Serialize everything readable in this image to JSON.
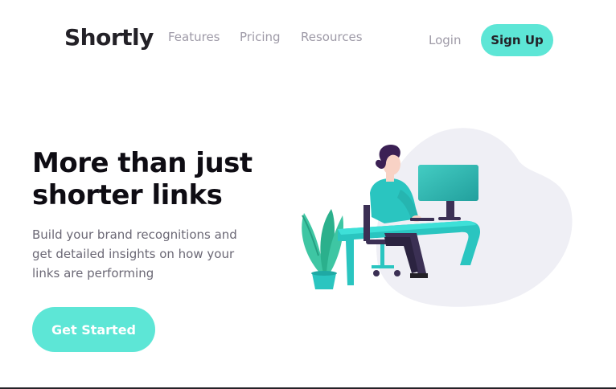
{
  "header": {
    "logo": "Shortly",
    "nav": [
      "Features",
      "Pricing",
      "Resources"
    ],
    "login_label": "Login",
    "signup_label": "Sign Up"
  },
  "hero": {
    "title_line1": "More than just",
    "title_line2": "shorter links",
    "subtitle_line1": "Build your brand recognitions and",
    "subtitle_line2": "get detailed insights on how your",
    "subtitle_line3": "links are performing",
    "cta_label": "Get Started"
  },
  "colors": {
    "accent": "#5de6d6",
    "text_dark": "#232127",
    "text_muted": "#9e9aa7",
    "blob": "#efeff5",
    "desk": "#2ac5c0"
  },
  "icons": [
    "person-at-desk-illustration",
    "plant-illustration",
    "monitor-illustration"
  ]
}
